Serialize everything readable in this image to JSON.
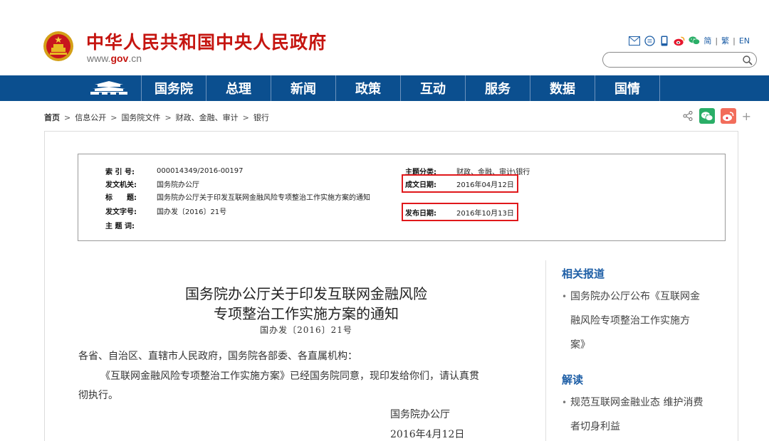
{
  "header": {
    "title": "中华人民共和国中央人民政府",
    "url_prefix": "www.",
    "url_accent": "gov",
    "url_suffix": ".cn",
    "tools": [
      "mail-icon",
      "message-icon",
      "mobile-icon",
      "weibo-icon",
      "wechat-icon"
    ],
    "lang_simplified": "简",
    "lang_traditional": "繁",
    "lang_english": "EN",
    "lang_sep": "|",
    "search_placeholder": ""
  },
  "nav": {
    "home_icon": "tiananmen-icon",
    "items": [
      "国务院",
      "总理",
      "新闻",
      "政策",
      "互动",
      "服务",
      "数据",
      "国情"
    ]
  },
  "breadcrumb": {
    "items": [
      "首页",
      "信息公开",
      "国务院文件",
      "财政、金融、审计",
      "银行"
    ],
    "sep": ">"
  },
  "share": {
    "plus": "+"
  },
  "meta": {
    "index_label": "索 引 号:",
    "index_value": "000014349/2016-00197",
    "issuer_label": "发文机关:",
    "issuer_value": "国务院办公厅",
    "title_label": "标　　题:",
    "title_value": "国务院办公厅关于印发互联网金融风险专项整治工作实施方案的通知",
    "docno_label": "发文字号:",
    "docno_value": "国办发〔2016〕21号",
    "keywords_label": "主 题 词:",
    "keywords_value": "",
    "category_label": "主题分类:",
    "category_value": "财政、金融、审计\\银行",
    "written_label": "成文日期:",
    "written_value": "2016年04月12日",
    "published_label": "发布日期:",
    "published_value": "2016年10月13日"
  },
  "article": {
    "title_line1": "国务院办公厅关于印发互联网金融风险",
    "title_line2": "专项整治工作实施方案的通知",
    "docno": "国办发〔2016〕21号",
    "addressee": "各省、自治区、直辖市人民政府，国务院各部委、各直属机构：",
    "body_line1": "《互联网金融风险专项整治工作实施方案》已经国务院同意，现印发给你们，请认真贯",
    "body_line2": "彻执行。",
    "signature": "国务院办公厅",
    "date": "2016年4月12日"
  },
  "sidebar": {
    "related_heading": "相关报道",
    "related_link_lines": [
      "国务院办公厅公布《互联网金",
      "融风险专项整治工作实施方",
      "案》"
    ],
    "interpret_heading": "解读",
    "interpret_link_lines": [
      "规范互联网金融业态 维护消费",
      "者切身利益"
    ],
    "bullet": "•"
  }
}
